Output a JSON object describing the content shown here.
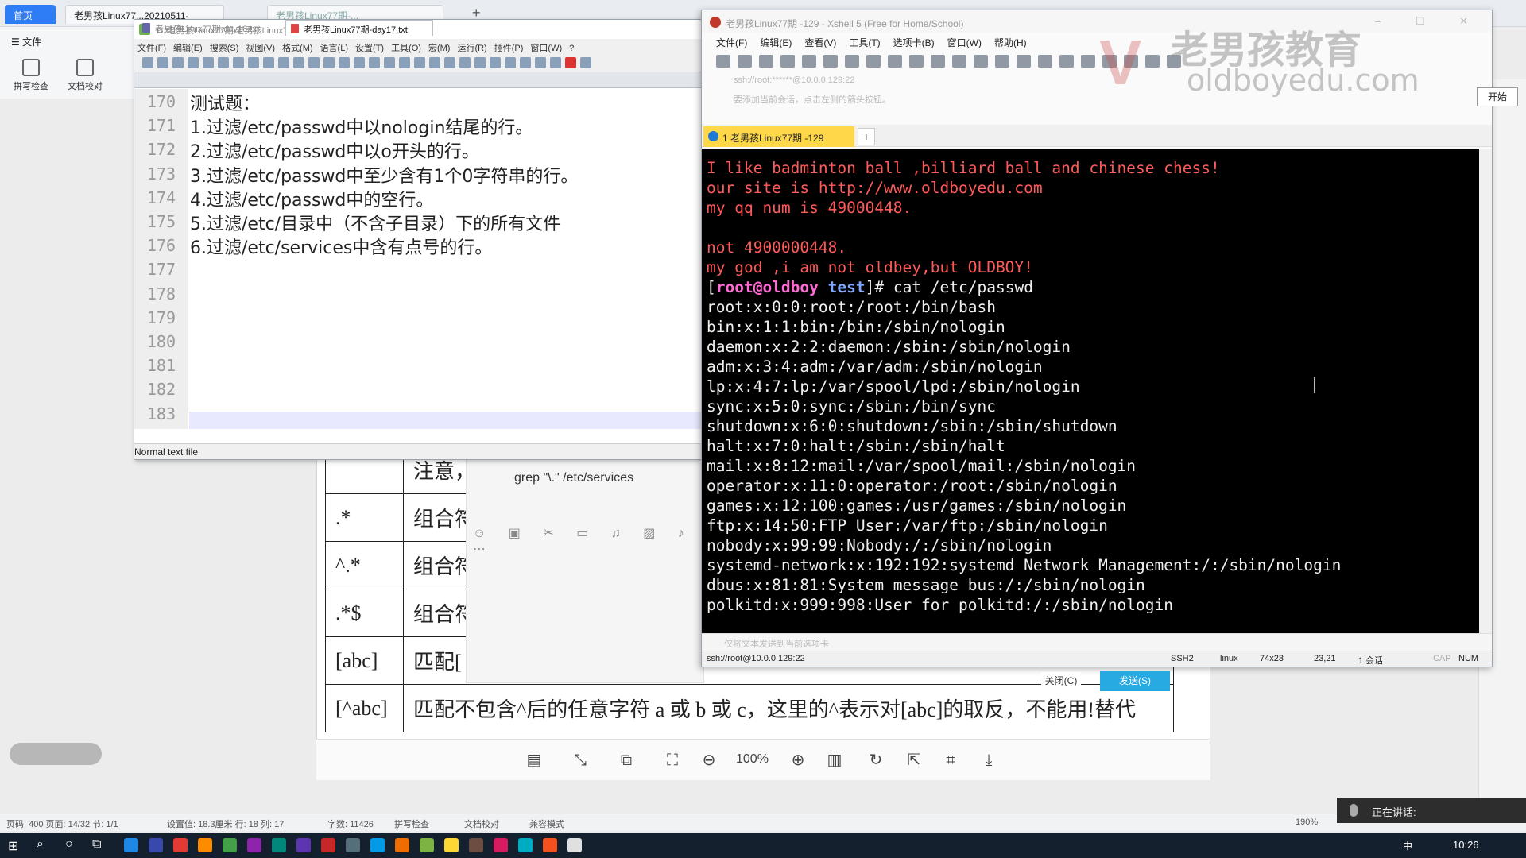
{
  "wps": {
    "tabs": [
      {
        "label": "首页"
      },
      {
        "label": "老男孩Linux77...20210511-"
      },
      {
        "label": "老男孩Linux77期-..."
      }
    ],
    "ribbon": {
      "file_menu": "文件",
      "spell_check": "拼写检查",
      "doc_proof": "文档校对"
    },
    "table_rows": [
      {
        "pattern": "",
        "desc": "注意，"
      },
      {
        "pattern": ".*",
        "desc": "组合符"
      },
      {
        "pattern": "^.*",
        "desc": "组合符"
      },
      {
        "pattern": ".*$",
        "desc": "组合符"
      },
      {
        "pattern": "[abc]",
        "desc": "匹配["
      },
      {
        "pattern": "[^abc]",
        "desc": "匹配不包含^后的任意字符 a 或 b 或 c，这里的^表示对[abc]的取反，不能用!替代"
      }
    ],
    "zoom": "100%",
    "status": {
      "page_info": "页码: 400  页面: 14/32  节: 1/1",
      "settings": "设置值: 18.3厘米  行: 18  列: 17",
      "word_count": "字数: 11426",
      "spell": "拼写检查",
      "proof": "文档校对",
      "mode": "兼容模式",
      "zoom": "190%"
    }
  },
  "chat": {
    "grep_line": "grep \"\\.\" /etc/services"
  },
  "npp": {
    "title": "D:\\老男孩Linux77期\\老男孩Linux77期-day17.txt - Notepad++",
    "menu": [
      "文件(F)",
      "编辑(E)",
      "搜索(S)",
      "视图(V)",
      "格式(M)",
      "语言(L)",
      "设置(T)",
      "工具(O)",
      "宏(M)",
      "运行(R)",
      "插件(P)",
      "窗口(W)",
      "?"
    ],
    "tabs": [
      {
        "label": "老男孩Linux77期-day16.txt"
      },
      {
        "label": "老男孩Linux77期-day17.txt"
      }
    ],
    "lines": [
      {
        "num": "170",
        "text": "测试题："
      },
      {
        "num": "171",
        "text": "1.过滤/etc/passwd中以nologin结尾的行。"
      },
      {
        "num": "172",
        "text": "2.过滤/etc/passwd中以o开头的行。"
      },
      {
        "num": "173",
        "text": "3.过滤/etc/passwd中至少含有1个0字符串的行。"
      },
      {
        "num": "174",
        "text": "4.过滤/etc/passwd中的空行。"
      },
      {
        "num": "175",
        "text": "5.过滤/etc/目录中（不含子目录）下的所有文件"
      },
      {
        "num": "176",
        "text": "6.过滤/etc/services中含有点号的行。"
      },
      {
        "num": "177",
        "text": ""
      },
      {
        "num": "178",
        "text": ""
      },
      {
        "num": "179",
        "text": ""
      },
      {
        "num": "180",
        "text": ""
      },
      {
        "num": "181",
        "text": ""
      },
      {
        "num": "182",
        "text": ""
      },
      {
        "num": "183",
        "text": ""
      }
    ],
    "status": "Normal text file"
  },
  "xshell": {
    "title": "老男孩Linux77期 -129 - Xshell 5 (Free for Home/School)",
    "menu": [
      "文件(F)",
      "编辑(E)",
      "查看(V)",
      "工具(T)",
      "选项卡(B)",
      "窗口(W)",
      "帮助(H)"
    ],
    "address": "ssh://root:******@10.0.0.129:22",
    "hint": "要添加当前会话，点击左侧的箭头按钮。",
    "tab_label": "1 老男孩Linux77期 -129",
    "tab_add": "+",
    "prompt": {
      "user": "root@oldboy",
      "dir": "test",
      "command": "cat /etc/passwd"
    },
    "red_lines": [
      "I like badminton ball ,billiard ball and chinese chess!",
      "our site is http://www.oldboyedu.com",
      "my qq num is 49000448.",
      "",
      "not 4900000448.",
      "my god ,i am not oldbey,but OLDBOY!"
    ],
    "output_lines": [
      "root:x:0:0:root:/root:/bin/bash",
      "bin:x:1:1:bin:/bin:/sbin/nologin",
      "daemon:x:2:2:daemon:/sbin:/sbin/nologin",
      "adm:x:3:4:adm:/var/adm:/sbin/nologin",
      "lp:x:4:7:lp:/var/spool/lpd:/sbin/nologin",
      "sync:x:5:0:sync:/sbin:/bin/sync",
      "shutdown:x:6:0:shutdown:/sbin:/sbin/shutdown",
      "halt:x:7:0:halt:/sbin:/sbin/halt",
      "mail:x:8:12:mail:/var/spool/mail:/sbin/nologin",
      "operator:x:11:0:operator:/root:/sbin/nologin",
      "games:x:12:100:games:/usr/games:/sbin/nologin",
      "ftp:x:14:50:FTP User:/var/ftp:/sbin/nologin",
      "nobody:x:99:99:Nobody:/:/sbin/nologin",
      "systemd-network:x:192:192:systemd Network Management:/:/sbin/nologin",
      "dbus:x:81:81:System message bus:/:/sbin/nologin",
      "polkitd:x:999:998:User for polkitd:/:/sbin/nologin"
    ],
    "compose_hint": "仅将文本发送到当前选项卡",
    "status": {
      "connection": "ssh://root@10.0.0.129:22",
      "protocol": "SSH2",
      "term": "linux",
      "size": "74x23",
      "cursor": "23,21",
      "sessions": "1 会话",
      "caps": "CAP",
      "num": "NUM"
    },
    "watermark_cn": "老男孩教育",
    "watermark_en": "oldboyedu.com",
    "start_label": "开始"
  },
  "dialog": {
    "close_label": "关闭(C)",
    "send_label": "发送(S)"
  },
  "speaking": {
    "label": "正在讲话:"
  },
  "taskbar": {
    "clock": "10:26",
    "ime": "中"
  }
}
